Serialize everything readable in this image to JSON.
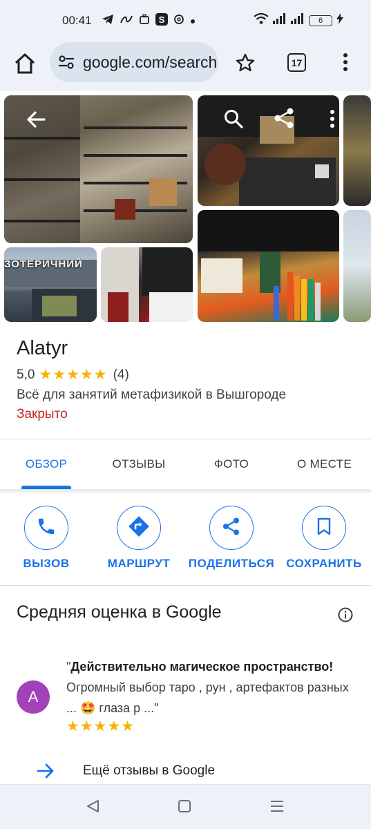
{
  "status_bar": {
    "time": "00:41",
    "battery": "6",
    "icons": [
      "telegram-icon",
      "link-icon",
      "briefcase-icon",
      "s-app-icon",
      "threads-icon",
      "dot-icon",
      "wifi-icon",
      "signal-icon",
      "signal-icon",
      "battery-icon",
      "charging-icon"
    ]
  },
  "toolbar": {
    "url": "google.com/search",
    "tab_count": "17"
  },
  "gallery": {
    "sign_text": "ЗОТЕРИЧНИЙ"
  },
  "place": {
    "name": "Alatyr",
    "rating": "5,0",
    "stars": "★★★★★",
    "review_count": "(4)",
    "category": "Всё для занятий метафизикой в Вышгороде",
    "status": "Закрыто",
    "status_color": "#c5221f"
  },
  "tabs": [
    {
      "label": "ОБЗОР",
      "active": true
    },
    {
      "label": "ОТЗЫВЫ",
      "active": false
    },
    {
      "label": "ФОТО",
      "active": false
    },
    {
      "label": "О МЕСТЕ",
      "active": false
    }
  ],
  "actions": [
    {
      "label": "ВЫЗОВ",
      "icon": "phone-icon"
    },
    {
      "label": "МАРШРУТ",
      "icon": "directions-icon"
    },
    {
      "label": "ПОДЕЛИТЬСЯ",
      "icon": "share-icon"
    },
    {
      "label": "СОХРАНИТЬ",
      "icon": "bookmark-icon"
    }
  ],
  "reviews": {
    "title": "Средняя оценка в Google",
    "items": [
      {
        "avatar_letter": "A",
        "avatar_color": "#a142b8",
        "quote_open": "\"",
        "bold": "Действительно магическое пространство!",
        "text": " Огромный выбор таро , рун , артефактов разных ... 🤩 глаза р ...\"",
        "stars": "★★★★★"
      }
    ],
    "more_link": "Ещё отзывы в Google"
  },
  "colors": {
    "accent": "#1a73e8",
    "star": "#f4b400"
  }
}
